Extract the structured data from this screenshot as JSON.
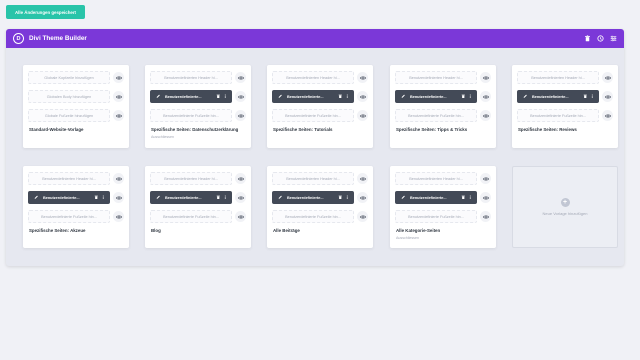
{
  "save_button": "Alle Änderungen gespeichert",
  "header": {
    "logo": "D",
    "title": "Divi Theme Builder",
    "icons": [
      "trash-icon",
      "history-icon",
      "settings-icon"
    ]
  },
  "row1": [
    {
      "header": "Globale Kopfzeile hinzufügen",
      "body": "Globalen Body hinzufügen",
      "footer": "Globale Fußzeile hinzufügen",
      "title": "Standard-Website-Vorlage",
      "sub": ""
    },
    {
      "header": "Benutzerdefinierten Header hi...",
      "body": "Benutzerdefinierte...",
      "footer": "Benutzerdefinierte Fußzeile hin...",
      "title": "Spezifische Seiten: Datenschutzerklärung",
      "sub": "Ausschliessen"
    },
    {
      "header": "Benutzerdefinierten Header hi...",
      "body": "Benutzerdefinierte...",
      "footer": "Benutzerdefinierte Fußzeile hin...",
      "title": "Spezifische Seiten: Tutorials",
      "sub": ""
    },
    {
      "header": "Benutzerdefinierten Header hi...",
      "body": "Benutzerdefinierte...",
      "footer": "Benutzerdefinierte Fußzeile hin...",
      "title": "Spezifische Seiten: Tipps & Tricks",
      "sub": ""
    },
    {
      "header": "Benutzerdefinierten Header hi...",
      "body": "Benutzerdefinierte...",
      "footer": "Benutzerdefinierte Fußzeile hin...",
      "title": "Spezifische Seiten: Reviews",
      "sub": ""
    }
  ],
  "row2": [
    {
      "header": "Benutzerdefinierten Header hi...",
      "body": "Benutzerdefinierte...",
      "footer": "Benutzerdefinierte Fußzeile hin...",
      "title": "Spezifische Seiten: Akzeue",
      "sub": ""
    },
    {
      "header": "Benutzerdefinierten Header hi...",
      "body": "Benutzerdefinierte...",
      "footer": "Benutzerdefinierte Fußzeile hin...",
      "title": "Blog",
      "sub": ""
    },
    {
      "header": "Benutzerdefinierten Header hi...",
      "body": "Benutzerdefinierte...",
      "footer": "Benutzerdefinierte Fußzeile hin...",
      "title": "Alle Beiträge",
      "sub": ""
    },
    {
      "header": "Benutzerdefinierten Header hi...",
      "body": "Benutzerdefinierte...",
      "footer": "Benutzerdefinierte Fußzeile hin...",
      "title": "Alle Kategorie-Seiten",
      "sub": "Ausschliessen"
    }
  ],
  "add_template": "Neue Vorlage hinzufügen"
}
